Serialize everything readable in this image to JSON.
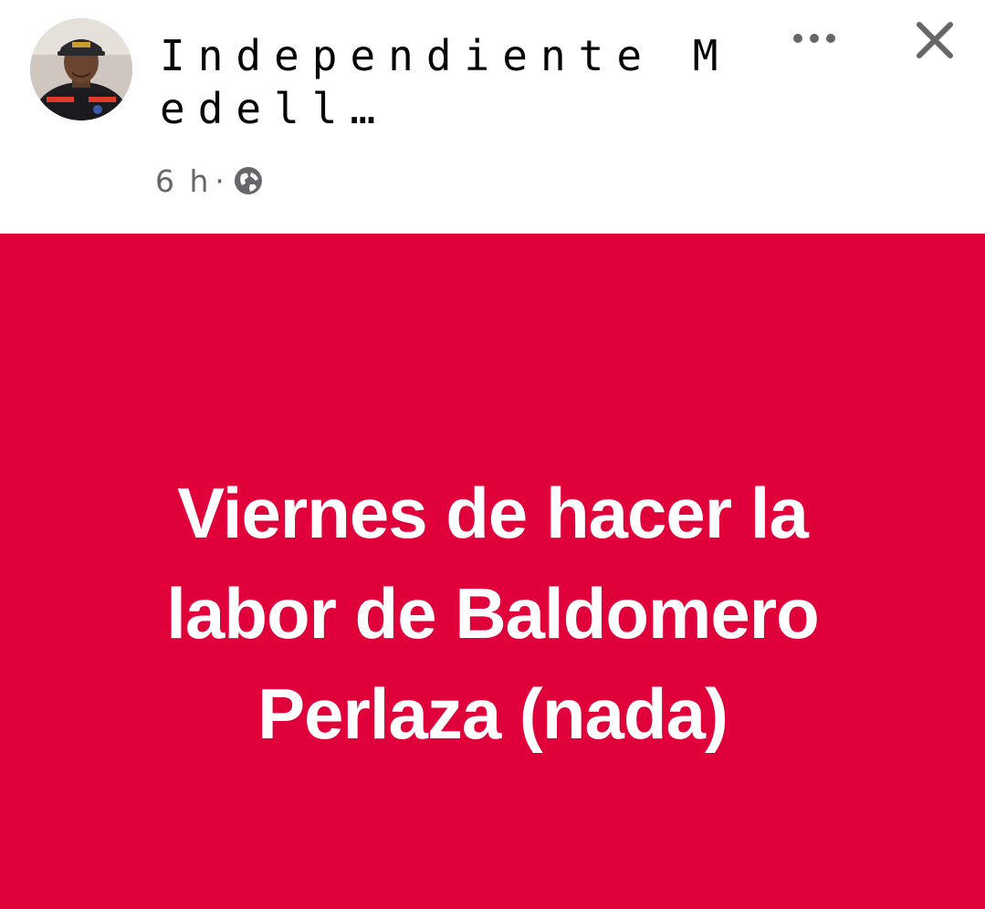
{
  "post": {
    "author_name": "Independiente Medell…",
    "timestamp": "6 h",
    "separator": "·",
    "privacy_icon": "globe-icon",
    "more_icon": "more-options-icon",
    "close_icon": "close-icon",
    "avatar_icon": "profile-photo"
  },
  "banner": {
    "text": "Viernes de hacer la labor de Baldomero Perlaza (nada)",
    "background_color": "#e0003a",
    "text_color": "#ffffff"
  }
}
